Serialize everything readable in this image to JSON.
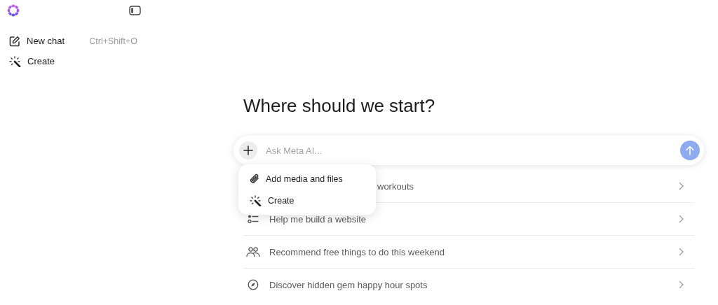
{
  "sidebar": {
    "items": [
      {
        "label": "New chat",
        "shortcut": "Ctrl+Shift+O"
      },
      {
        "label": "Create"
      }
    ]
  },
  "heading": "Where should we start?",
  "composer": {
    "placeholder": "Ask Meta AI..."
  },
  "attach_menu": {
    "items": [
      {
        "label": "Add media and files"
      },
      {
        "label": "Create"
      }
    ]
  },
  "suggestions": [
    {
      "label": "workouts",
      "covered": true
    },
    {
      "label": "Help me build a website",
      "covered": false
    },
    {
      "label": "Recommend free things to do this weekend",
      "covered": false
    },
    {
      "label": "Discover hidden gem happy hour spots",
      "covered": false
    }
  ]
}
